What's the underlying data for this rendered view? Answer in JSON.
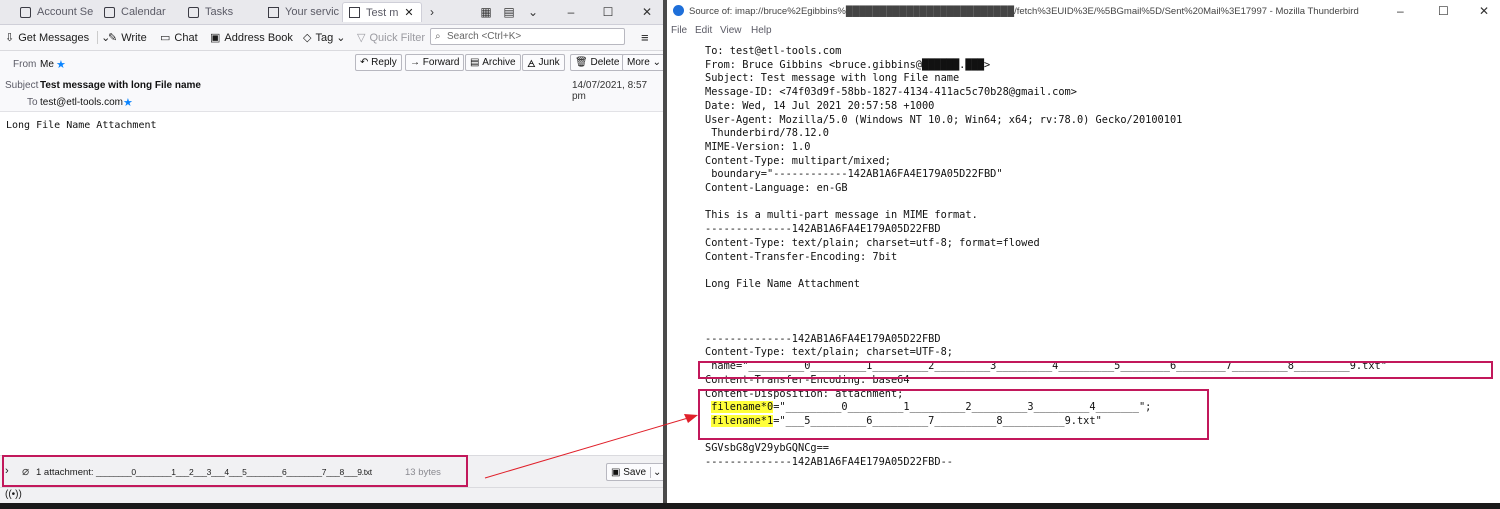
{
  "left": {
    "tabs": [
      {
        "label": "Account Se",
        "icon": "account-icon",
        "active": false
      },
      {
        "label": "Calendar",
        "icon": "calendar-icon",
        "active": false
      },
      {
        "label": "Tasks",
        "icon": "tasks-icon",
        "active": false
      },
      {
        "label": "Your servic",
        "icon": "mail-icon",
        "active": false
      },
      {
        "label": "Test m",
        "icon": "mail-icon",
        "active": true
      }
    ],
    "tab_close": "✕",
    "toolbar": {
      "get_messages": "Get Messages",
      "write": "Write",
      "chat": "Chat",
      "address_book": "Address Book",
      "tag": "Tag",
      "quick_filter": "Quick Filter",
      "search_placeholder": "Search <Ctrl+K>"
    },
    "header": {
      "from_label": "From",
      "from_value": "Me",
      "subject_label": "Subject",
      "subject_value": "Test message with long File name",
      "to_label": "To",
      "to_value": "test@etl-tools.com",
      "date": "14/07/2021, 8:57 pm",
      "buttons": {
        "reply": "Reply",
        "forward": "Forward",
        "archive": "Archive",
        "junk": "Junk",
        "delete": "Delete",
        "more": "More"
      }
    },
    "body_text": "Long File Name Attachment",
    "attachment": {
      "summary": "1 attachment:",
      "filename": "________0________1___2___3___4___5________6________7___8___9.txt",
      "size": "13 bytes",
      "save": "Save"
    }
  },
  "right": {
    "title": "Source of: imap://bruce%2Egibbins%█████████████████████████/fetch%3EUID%3E/%5BGmail%5D/Sent%20Mail%3E17997 - Mozilla Thunderbird",
    "menu": [
      "File",
      "Edit",
      "View",
      "Help"
    ],
    "source_lines": [
      "To: test@etl-tools.com",
      "From: Bruce Gibbins <bruce.gibbins@██████.███>",
      "Subject: Test message with long File name",
      "Message-ID: <74f03d9f-58bb-1827-4134-411ac5c70b28@gmail.com>",
      "Date: Wed, 14 Jul 2021 20:57:58 +1000",
      "User-Agent: Mozilla/5.0 (Windows NT 10.0; Win64; x64; rv:78.0) Gecko/20100101",
      " Thunderbird/78.12.0",
      "MIME-Version: 1.0",
      "Content-Type: multipart/mixed;",
      " boundary=\"------------142AB1A6FA4E179A05D22FBD\"",
      "Content-Language: en-GB",
      "",
      "This is a multi-part message in MIME format.",
      "--------------142AB1A6FA4E179A05D22FBD",
      "Content-Type: text/plain; charset=utf-8; format=flowed",
      "Content-Transfer-Encoding: 7bit",
      "",
      "Long File Name Attachment",
      "",
      "",
      "",
      "--------------142AB1A6FA4E179A05D22FBD",
      "Content-Type: text/plain; charset=UTF-8;",
      " name=\"_________0_________1_________2_________3_________4_________5________6________7_________8_________9.txt\"",
      "Content-Transfer-Encoding: base64",
      "Content-Disposition: attachment;",
      "",
      "",
      "",
      "SGVsbG8gV29ybGQNCg==",
      "--------------142AB1A6FA4E179A05D22FBD--"
    ],
    "filename_lines": [
      {
        "key": "filename*0",
        "value": "=\"_________0_________1_________2_________3_________4_______\";"
      },
      {
        "key": "filename*1",
        "value": "=\"___5_________6_________7__________8__________9.txt\""
      }
    ]
  },
  "colors": {
    "annotation_red": "#c2185b",
    "highlight_yellow": "#ffff3a",
    "accent_blue": "#0a84ff"
  }
}
